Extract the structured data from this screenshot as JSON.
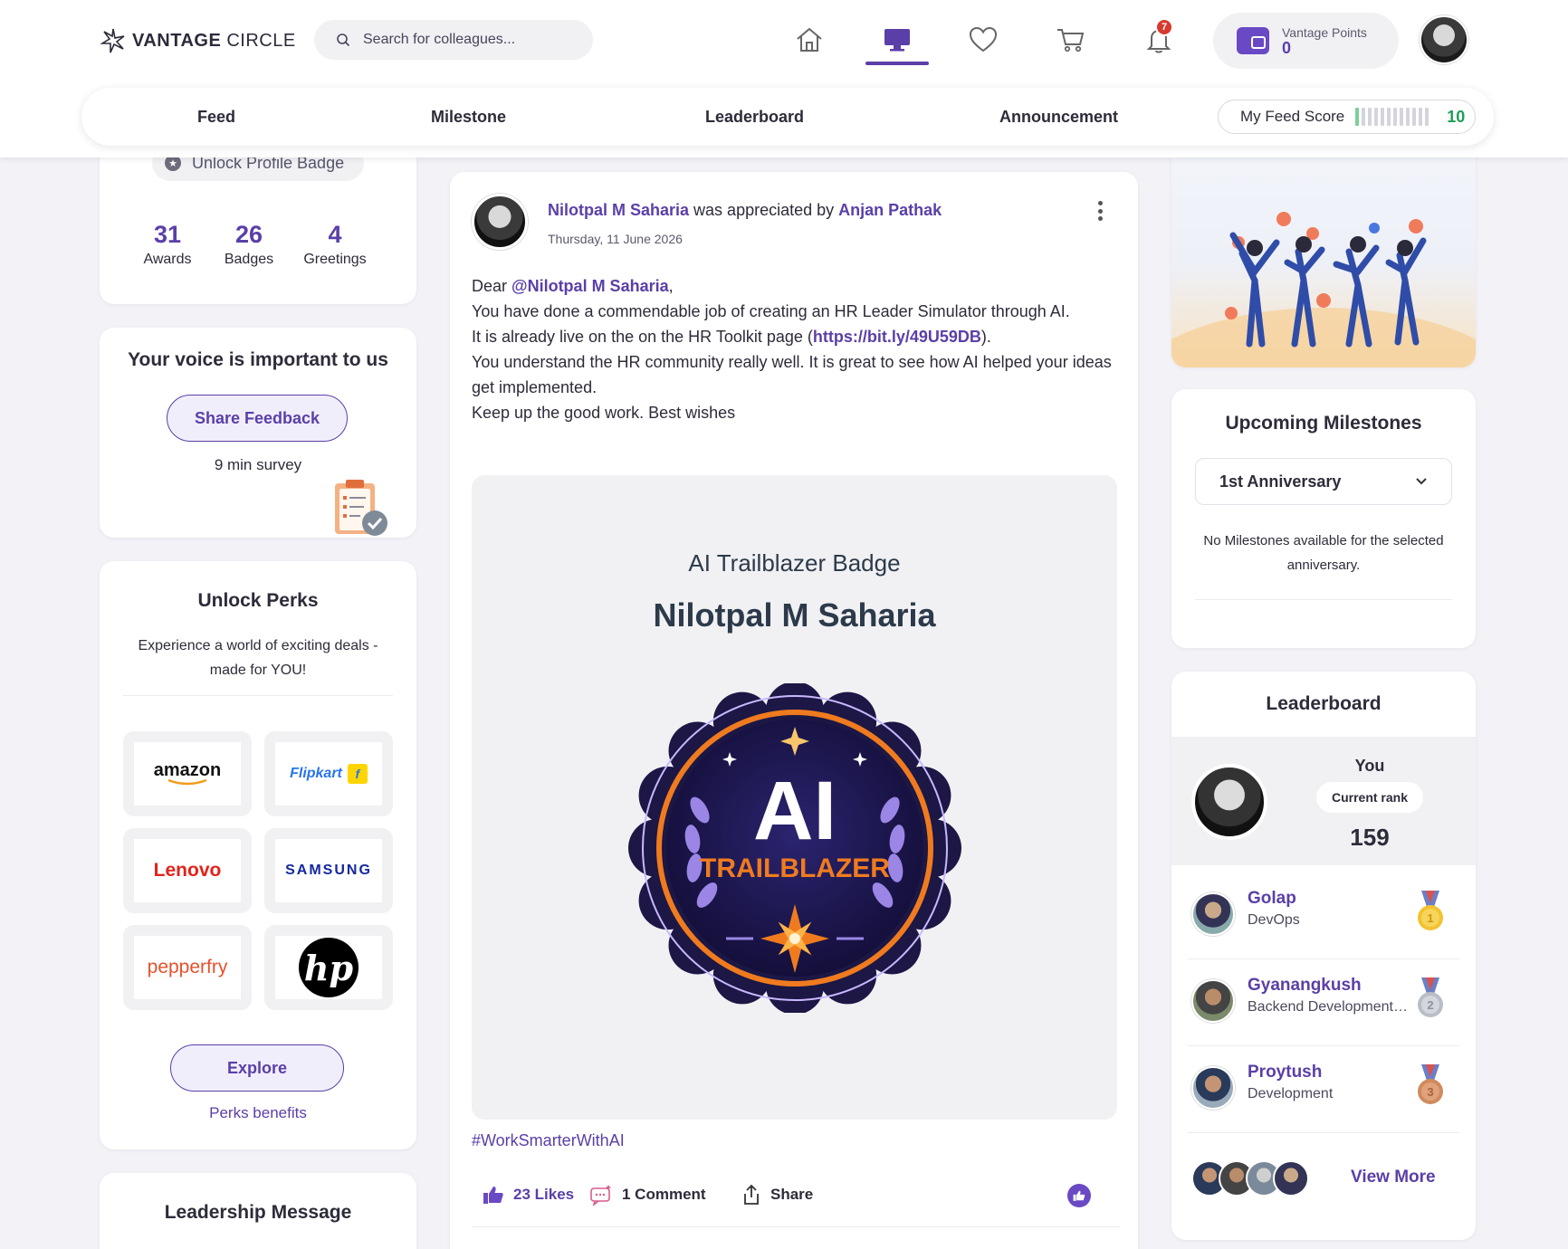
{
  "header": {
    "logo_bold": "VANTAGE",
    "logo_light": "CIRCLE",
    "search_placeholder": "Search for colleagues...",
    "nav_icons": [
      "home-icon",
      "desktop-feed-icon",
      "heart-icon",
      "cart-icon",
      "bell-icon"
    ],
    "notification_count": "7",
    "points_label": "Vantage Points",
    "points_value": "0"
  },
  "subnav": {
    "tabs": [
      "Feed",
      "Milestone",
      "Leaderboard",
      "Announcement"
    ],
    "feed_score_label": "My Feed Score",
    "feed_score_value": "10",
    "feed_score_fill": 0.1
  },
  "profile": {
    "unlock_badge": "Unlock Profile Badge",
    "stats": [
      {
        "num": "31",
        "label": "Awards"
      },
      {
        "num": "26",
        "label": "Badges"
      },
      {
        "num": "4",
        "label": "Greetings"
      }
    ]
  },
  "voice": {
    "title": "Your voice is important to us",
    "button": "Share Feedback",
    "survey": "9 min survey"
  },
  "perks": {
    "title": "Unlock Perks",
    "description": "Experience a world of exciting deals - made for YOU!",
    "brands": [
      "amazon",
      "Flipkart",
      "Lenovo",
      "SAMSUNG",
      "pepperfry",
      "hp"
    ],
    "explore": "Explore",
    "benefits": "Perks benefits"
  },
  "leadership": {
    "title": "Leadership Message"
  },
  "post": {
    "author": "Nilotpal M Saharia",
    "verb": " was appreciated by ",
    "appreciator": "Anjan Pathak",
    "date": "Thursday, 11 June 2026",
    "salutation": "Dear ",
    "mention": "@Nilotpal M Saharia",
    "line1": "You have done a commendable job of creating an HR Leader Simulator through AI.",
    "line2_pre": "It is already live on the on the HR Toolkit page (",
    "link": "https://bit.ly/49U59DB",
    "line2_post": ").",
    "line3": "You understand the HR community really well. It is great to see how AI helped your ideas get implemented.",
    "line4": "Keep up the good work. Best wishes",
    "badge_title": "AI Trailblazer Badge",
    "badge_name": "Nilotpal M Saharia",
    "badge_art_big": "AI",
    "badge_art_small": "TRAILBLAZER",
    "hashtag": "#WorkSmarterWithAI",
    "likes": "23 Likes",
    "comments": "1 Comment",
    "share": "Share"
  },
  "milestones": {
    "title": "Upcoming Milestones",
    "selected": "1st Anniversary",
    "empty": "No Milestones available for the selected anniversary."
  },
  "leaderboard": {
    "title": "Leaderboard",
    "you_label": "You",
    "rank_label": "Current rank",
    "rank_value": "159",
    "entries": [
      {
        "name": "Golap",
        "role": "DevOps",
        "medal": "1"
      },
      {
        "name": "Gyanangkush",
        "role": "Backend Development…",
        "medal": "2"
      },
      {
        "name": "Proytush",
        "role": "Development",
        "medal": "3"
      }
    ],
    "view_more": "View More"
  },
  "colors": {
    "accent": "#5b3fa8",
    "score_green": "#1e9e56",
    "badge_orange": "#f07b1f",
    "badge_navy": "#1c1745"
  }
}
